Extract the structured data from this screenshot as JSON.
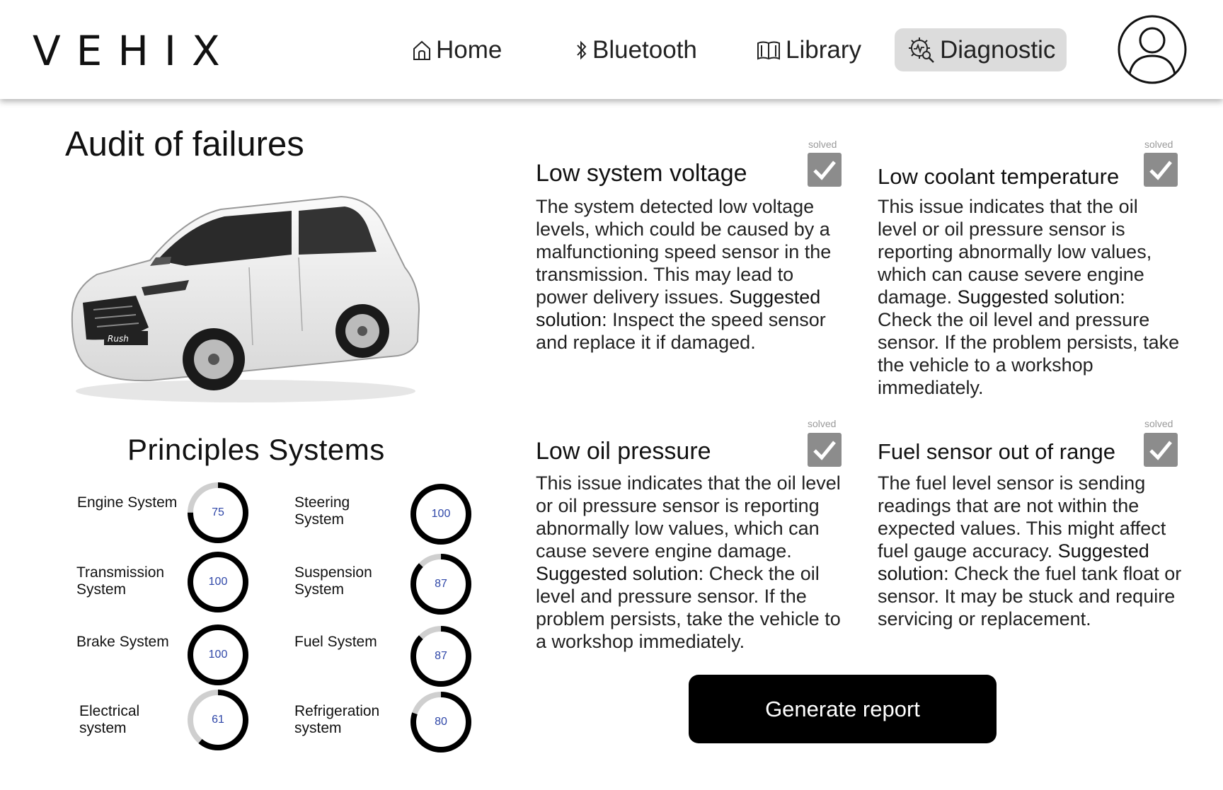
{
  "app": {
    "logo": "VEHIX"
  },
  "nav": {
    "home": "Home",
    "bluetooth": "Bluetooth",
    "library": "Library",
    "diagnostic": "Diagnostic",
    "active": "diagnostic"
  },
  "page": {
    "title": "Audit of failures"
  },
  "systems": {
    "title": "Principles Systems",
    "items": [
      {
        "label": "Engine System",
        "value": 75
      },
      {
        "label": "Steering System",
        "value": 100
      },
      {
        "label": "Transmission System",
        "value": 100
      },
      {
        "label": "Suspension System",
        "value": 87
      },
      {
        "label": "Brake System",
        "value": 100
      },
      {
        "label": "Fuel System",
        "value": 87
      },
      {
        "label": "Electrical system",
        "value": 61
      },
      {
        "label": "Refrigeration system",
        "value": 80
      }
    ]
  },
  "failures": [
    {
      "title": "Low system voltage",
      "description": "The system detected low voltage levels, which could be caused by a malfunctioning speed sensor in the transmission. This may lead to power delivery issues.",
      "solution_label": "Suggested solution:",
      "solution": " Inspect the speed sensor and replace it if damaged.",
      "solved_label": "solved",
      "solved": true
    },
    {
      "title": "Low coolant temperature",
      "description": "This issue indicates that the oil level or oil pressure sensor is reporting abnormally low values, which can cause severe engine damage.",
      "solution_label": "Suggested solution:",
      "solution": " Check the oil level and pressure sensor. If the problem persists, take the vehicle to a workshop immediately.",
      "solved_label": "solved",
      "solved": true
    },
    {
      "title": "Low oil pressure",
      "description": "This issue indicates that the oil level or oil pressure sensor is reporting abnormally low values, which can cause severe engine damage.",
      "solution_label": "Suggested solution:",
      "solution": " Check the oil level and pressure sensor. If the problem persists, take the vehicle to a workshop immediately.",
      "solved_label": "solved",
      "solved": true
    },
    {
      "title": "Fuel sensor out of range",
      "description": "The fuel level sensor is sending readings that are not within the expected values. This might affect fuel gauge accuracy.",
      "solution_label": "Suggested solution:",
      "solution": " Check the fuel tank float or sensor. It may be stuck and require servicing or replacement.",
      "solved_label": "solved",
      "solved": true
    }
  ],
  "actions": {
    "generate_report": "Generate report"
  },
  "icons": {
    "home": "home-icon",
    "bluetooth": "bluetooth-icon",
    "library": "book-icon",
    "diagnostic": "diagnostic-gear-icon",
    "avatar": "user-avatar-icon",
    "checkbox": "check-icon"
  }
}
